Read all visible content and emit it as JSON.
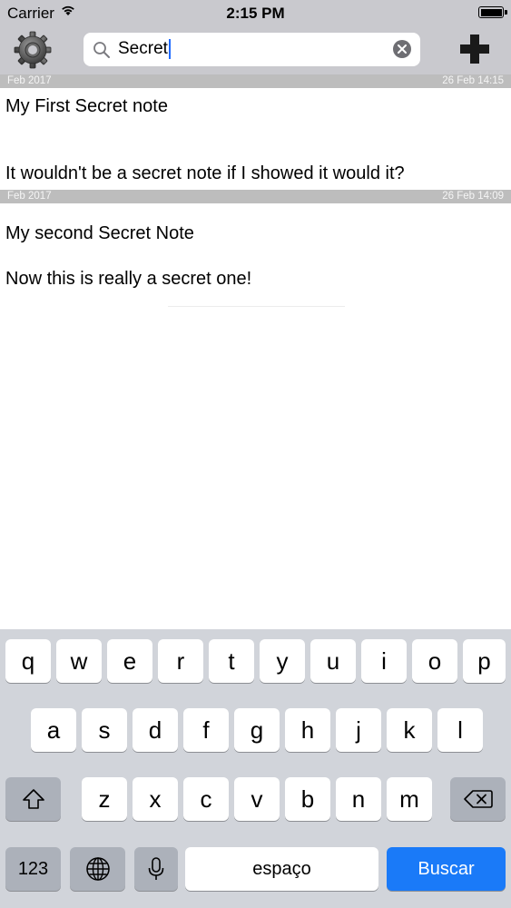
{
  "status_bar": {
    "carrier": "Carrier",
    "time": "2:15 PM"
  },
  "search": {
    "query": "Secret"
  },
  "notes": [
    {
      "header_left": "Feb 2017",
      "header_right": "26 Feb 14:15",
      "title": "My First Secret note",
      "body": "It wouldn't be a secret note if I showed it would it?"
    },
    {
      "header_left": "Feb 2017",
      "header_right": "26 Feb 14:09",
      "title": "My second Secret Note",
      "body": "Now this is really a secret one!"
    }
  ],
  "keyboard": {
    "row1": [
      "q",
      "w",
      "e",
      "r",
      "t",
      "y",
      "u",
      "i",
      "o",
      "p"
    ],
    "row2": [
      "a",
      "s",
      "d",
      "f",
      "g",
      "h",
      "j",
      "k",
      "l"
    ],
    "row3": [
      "z",
      "x",
      "c",
      "v",
      "b",
      "n",
      "m"
    ],
    "numbers_label": "123",
    "space_label": "espaço",
    "return_label": "Buscar"
  },
  "colors": {
    "accent": "#1a7af8",
    "bar": "#c9c9ce",
    "note_header": "#bdbdbd"
  },
  "icons": [
    "wifi-icon",
    "battery-icon",
    "gear-icon",
    "plus-icon",
    "search-icon",
    "clear-icon",
    "shift-icon",
    "backspace-icon",
    "globe-icon",
    "mic-icon"
  ]
}
